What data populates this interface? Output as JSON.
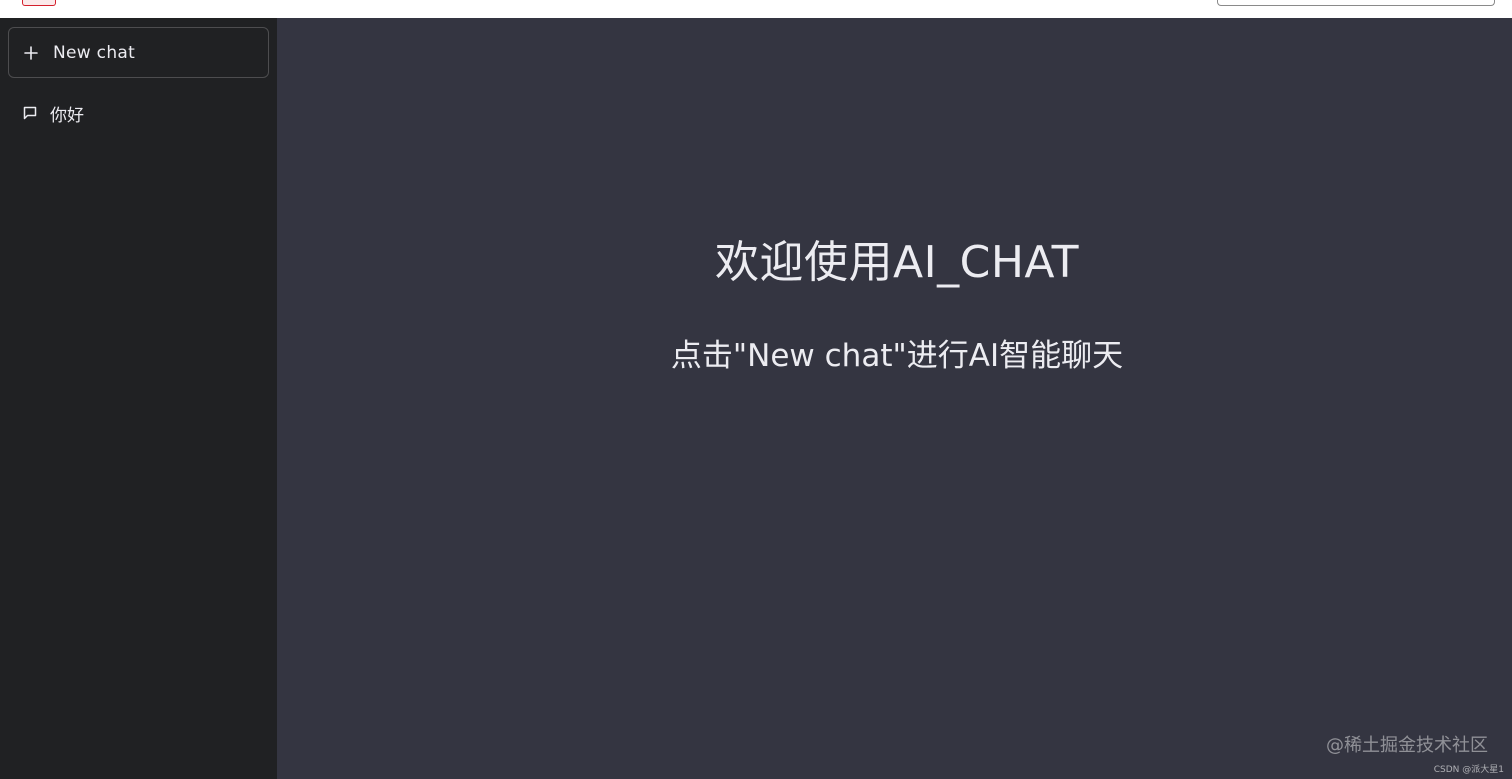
{
  "sidebar": {
    "new_chat_label": "New chat",
    "chats": [
      {
        "label": "你好"
      }
    ]
  },
  "main": {
    "title": "欢迎使用AI_CHAT",
    "subtitle": "点击\"New chat\"进行AI智能聊天"
  },
  "watermarks": {
    "primary": "@稀土掘金技术社区",
    "secondary": "CSDN @派大星1"
  },
  "colors": {
    "sidebar_bg": "#202123",
    "main_bg": "#343541",
    "text": "#ececf1",
    "border": "#4d4d4f"
  },
  "icons": {
    "new_chat": "plus-icon",
    "chat_item": "message-square-icon"
  }
}
